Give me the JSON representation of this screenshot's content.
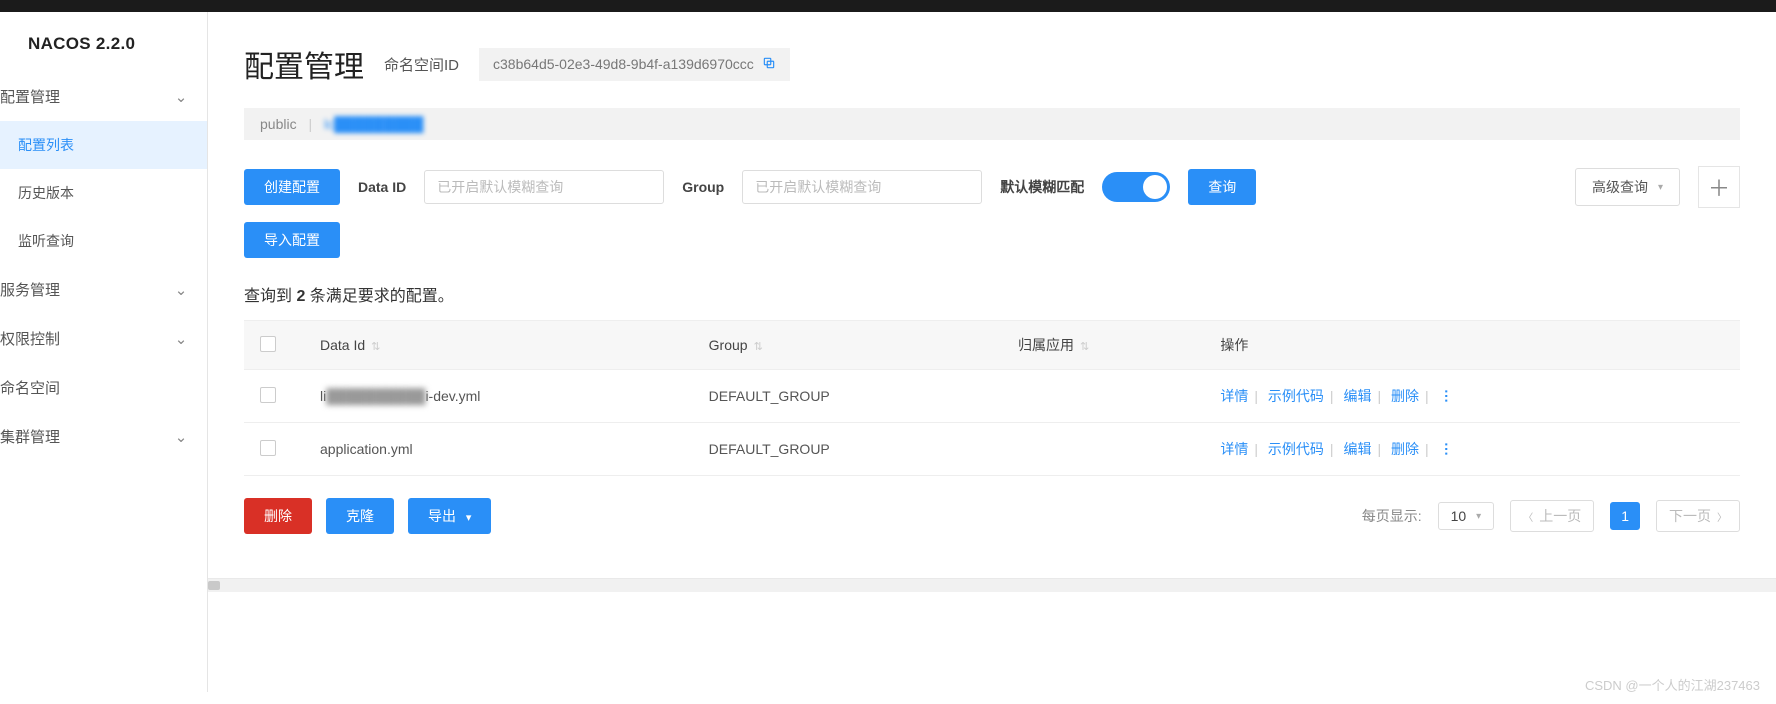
{
  "brand": "NACOS 2.2.0",
  "sidebar": {
    "items": [
      {
        "label": "配置管理",
        "expandable": true
      },
      {
        "label": "配置列表",
        "sub": true,
        "active": true
      },
      {
        "label": "历史版本",
        "sub": true
      },
      {
        "label": "监听查询",
        "sub": true
      },
      {
        "label": "服务管理",
        "expandable": true
      },
      {
        "label": "权限控制",
        "expandable": true
      },
      {
        "label": "命名空间"
      },
      {
        "label": "集群管理",
        "expandable": true
      }
    ]
  },
  "page": {
    "title": "配置管理",
    "ns_label": "命名空间ID",
    "ns_value": "c38b64d5-02e3-49d8-9b4f-a139d6970ccc",
    "breadcrumb": {
      "public": "public",
      "sep": "|",
      "current": "lc█████████"
    }
  },
  "toolbar": {
    "create": "创建配置",
    "import": "导入配置",
    "data_id_label": "Data ID",
    "data_id_placeholder": "已开启默认模糊查询",
    "group_label": "Group",
    "group_placeholder": "已开启默认模糊查询",
    "fuzzy_label": "默认模糊匹配",
    "query": "查询",
    "advanced": "高级查询"
  },
  "result": {
    "prefix": "查询到 ",
    "count": "2",
    "suffix": " 条满足要求的配置。"
  },
  "table": {
    "headers": {
      "data_id": "Data Id",
      "group": "Group",
      "app": "归属应用",
      "ops": "操作"
    },
    "rows": [
      {
        "data_id_pre": "li",
        "data_id_mask": "██████████",
        "data_id_post": "i-dev.yml",
        "group": "DEFAULT_GROUP",
        "app": ""
      },
      {
        "data_id_pre": "application.yml",
        "data_id_mask": "",
        "data_id_post": "",
        "group": "DEFAULT_GROUP",
        "app": ""
      }
    ],
    "ops": {
      "detail": "详情",
      "sample": "示例代码",
      "edit": "编辑",
      "delete": "删除"
    }
  },
  "footer": {
    "delete": "删除",
    "clone": "克隆",
    "export": "导出",
    "page_size_label": "每页显示:",
    "page_size_value": "10",
    "prev": "上一页",
    "next": "下一页",
    "current_page": "1"
  },
  "watermark": "CSDN @一个人的江湖237463"
}
